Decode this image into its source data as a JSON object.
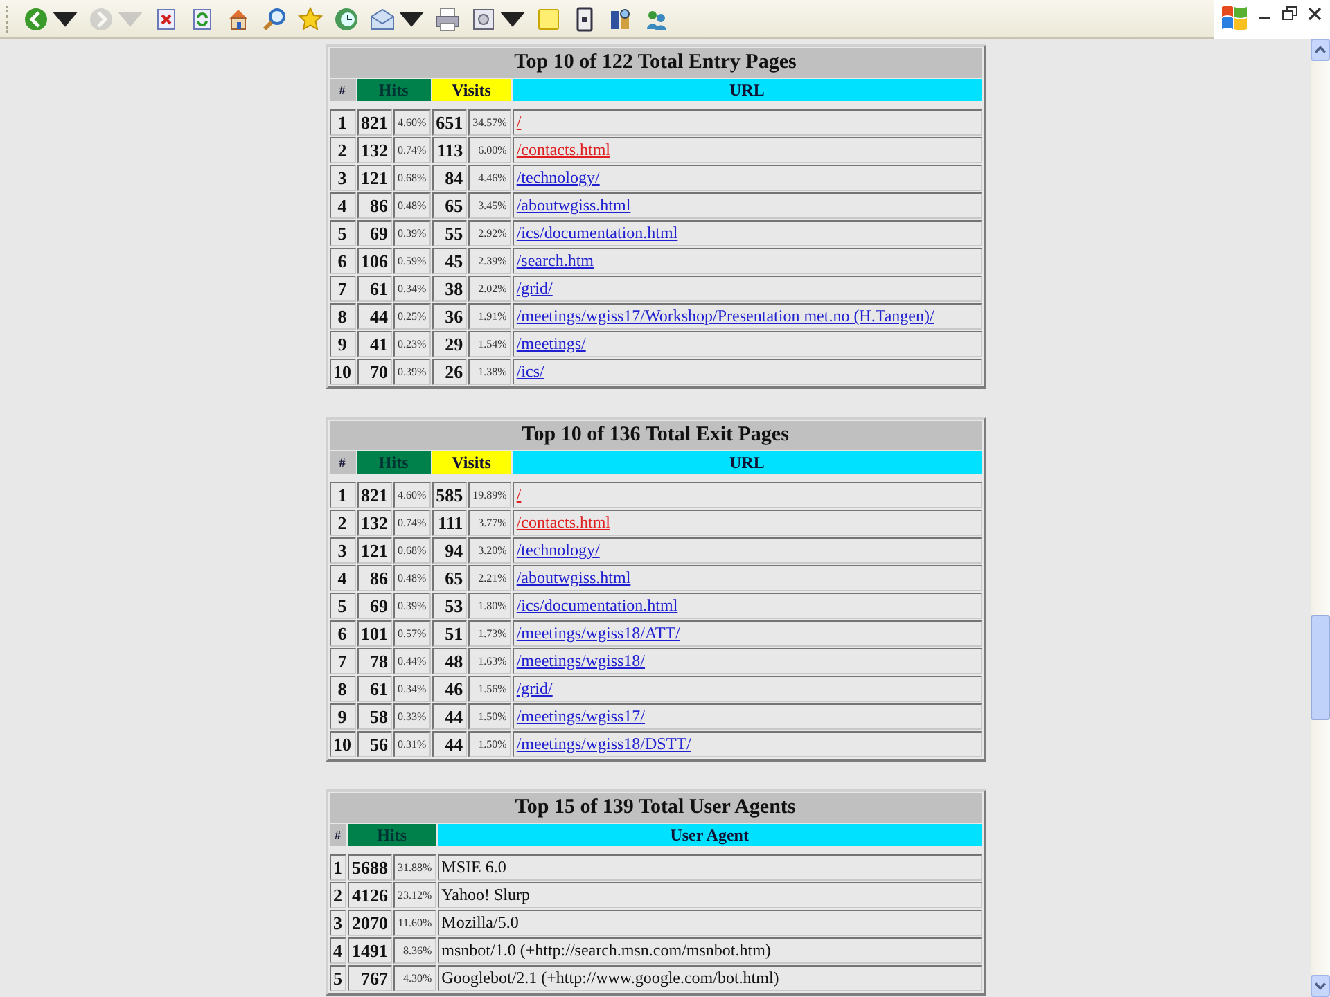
{
  "toolbar": {
    "buttons": [
      {
        "kind": "back",
        "dropdown": true,
        "disabled": false
      },
      {
        "kind": "forward",
        "dropdown": true,
        "disabled": true
      },
      {
        "kind": "stop",
        "dropdown": false,
        "disabled": false
      },
      {
        "kind": "refresh",
        "dropdown": false,
        "disabled": false
      },
      {
        "kind": "home",
        "dropdown": false,
        "disabled": false
      },
      {
        "kind": "search",
        "dropdown": false,
        "disabled": false
      },
      {
        "kind": "favorites",
        "dropdown": false,
        "disabled": false
      },
      {
        "kind": "history",
        "dropdown": false,
        "disabled": false
      },
      {
        "kind": "mail",
        "dropdown": true,
        "disabled": false
      },
      {
        "kind": "print",
        "dropdown": false,
        "disabled": false
      },
      {
        "kind": "edit",
        "dropdown": true,
        "disabled": false
      },
      {
        "kind": "note",
        "dropdown": false,
        "disabled": false
      },
      {
        "kind": "device",
        "dropdown": false,
        "disabled": false
      },
      {
        "kind": "research",
        "dropdown": false,
        "disabled": false
      },
      {
        "kind": "messenger",
        "dropdown": false,
        "disabled": false
      }
    ],
    "window_controls": [
      {
        "kind": "minimize"
      },
      {
        "kind": "restore"
      },
      {
        "kind": "close"
      }
    ]
  },
  "tables": [
    {
      "kind": "pages",
      "title": "Top 10 of 122 Total Entry Pages",
      "columns": [
        {
          "kind": "rank",
          "label": "#",
          "color": "#c0c0c0"
        },
        {
          "kind": "count",
          "label": "Hits",
          "color": "#00804a"
        },
        {
          "kind": "count",
          "label": "Visits",
          "color": "#ffff00"
        },
        {
          "kind": "text",
          "label": "URL",
          "color": "#00e0ff"
        }
      ],
      "rows": [
        {
          "rank": "1",
          "hits": "821",
          "hits_pct": "4.60%",
          "visits": "651",
          "visits_pct": "34.57%",
          "text": "/",
          "visited": true
        },
        {
          "rank": "2",
          "hits": "132",
          "hits_pct": "0.74%",
          "visits": "113",
          "visits_pct": "6.00%",
          "text": "/contacts.html",
          "visited": true
        },
        {
          "rank": "3",
          "hits": "121",
          "hits_pct": "0.68%",
          "visits": "84",
          "visits_pct": "4.46%",
          "text": "/technology/",
          "visited": false
        },
        {
          "rank": "4",
          "hits": "86",
          "hits_pct": "0.48%",
          "visits": "65",
          "visits_pct": "3.45%",
          "text": "/aboutwgiss.html",
          "visited": false
        },
        {
          "rank": "5",
          "hits": "69",
          "hits_pct": "0.39%",
          "visits": "55",
          "visits_pct": "2.92%",
          "text": "/ics/documentation.html",
          "visited": false
        },
        {
          "rank": "6",
          "hits": "106",
          "hits_pct": "0.59%",
          "visits": "45",
          "visits_pct": "2.39%",
          "text": "/search.htm",
          "visited": false
        },
        {
          "rank": "7",
          "hits": "61",
          "hits_pct": "0.34%",
          "visits": "38",
          "visits_pct": "2.02%",
          "text": "/grid/",
          "visited": false
        },
        {
          "rank": "8",
          "hits": "44",
          "hits_pct": "0.25%",
          "visits": "36",
          "visits_pct": "1.91%",
          "text": "/meetings/wgiss17/Workshop/Presentation met.no (H.Tangen)/",
          "visited": false
        },
        {
          "rank": "9",
          "hits": "41",
          "hits_pct": "0.23%",
          "visits": "29",
          "visits_pct": "1.54%",
          "text": "/meetings/",
          "visited": false
        },
        {
          "rank": "10",
          "hits": "70",
          "hits_pct": "0.39%",
          "visits": "26",
          "visits_pct": "1.38%",
          "text": "/ics/",
          "visited": false
        }
      ]
    },
    {
      "kind": "pages",
      "title": "Top 10 of 136 Total Exit Pages",
      "columns": [
        {
          "kind": "rank",
          "label": "#",
          "color": "#c0c0c0"
        },
        {
          "kind": "count",
          "label": "Hits",
          "color": "#00804a"
        },
        {
          "kind": "count",
          "label": "Visits",
          "color": "#ffff00"
        },
        {
          "kind": "text",
          "label": "URL",
          "color": "#00e0ff"
        }
      ],
      "rows": [
        {
          "rank": "1",
          "hits": "821",
          "hits_pct": "4.60%",
          "visits": "585",
          "visits_pct": "19.89%",
          "text": "/",
          "visited": true
        },
        {
          "rank": "2",
          "hits": "132",
          "hits_pct": "0.74%",
          "visits": "111",
          "visits_pct": "3.77%",
          "text": "/contacts.html",
          "visited": true
        },
        {
          "rank": "3",
          "hits": "121",
          "hits_pct": "0.68%",
          "visits": "94",
          "visits_pct": "3.20%",
          "text": "/technology/",
          "visited": false
        },
        {
          "rank": "4",
          "hits": "86",
          "hits_pct": "0.48%",
          "visits": "65",
          "visits_pct": "2.21%",
          "text": "/aboutwgiss.html",
          "visited": false
        },
        {
          "rank": "5",
          "hits": "69",
          "hits_pct": "0.39%",
          "visits": "53",
          "visits_pct": "1.80%",
          "text": "/ics/documentation.html",
          "visited": false
        },
        {
          "rank": "6",
          "hits": "101",
          "hits_pct": "0.57%",
          "visits": "51",
          "visits_pct": "1.73%",
          "text": "/meetings/wgiss18/ATT/",
          "visited": false
        },
        {
          "rank": "7",
          "hits": "78",
          "hits_pct": "0.44%",
          "visits": "48",
          "visits_pct": "1.63%",
          "text": "/meetings/wgiss18/",
          "visited": false
        },
        {
          "rank": "8",
          "hits": "61",
          "hits_pct": "0.34%",
          "visits": "46",
          "visits_pct": "1.56%",
          "text": "/grid/",
          "visited": false
        },
        {
          "rank": "9",
          "hits": "58",
          "hits_pct": "0.33%",
          "visits": "44",
          "visits_pct": "1.50%",
          "text": "/meetings/wgiss17/",
          "visited": false
        },
        {
          "rank": "10",
          "hits": "56",
          "hits_pct": "0.31%",
          "visits": "44",
          "visits_pct": "1.50%",
          "text": "/meetings/wgiss18/DSTT/",
          "visited": false
        }
      ]
    },
    {
      "kind": "agents",
      "title": "Top 15 of 139 Total User Agents",
      "columns": [
        {
          "kind": "rank",
          "label": "#",
          "color": "#c0c0c0"
        },
        {
          "kind": "count",
          "label": "Hits",
          "color": "#00804a"
        },
        {
          "kind": "text",
          "label": "User Agent",
          "color": "#00e0ff"
        }
      ],
      "rows": [
        {
          "rank": "1",
          "hits": "5688",
          "hits_pct": "31.88%",
          "text": "MSIE 6.0"
        },
        {
          "rank": "2",
          "hits": "4126",
          "hits_pct": "23.12%",
          "text": "Yahoo! Slurp"
        },
        {
          "rank": "3",
          "hits": "2070",
          "hits_pct": "11.60%",
          "text": "Mozilla/5.0"
        },
        {
          "rank": "4",
          "hits": "1491",
          "hits_pct": "8.36%",
          "text": "msnbot/1.0 (+http://search.msn.com/msnbot.htm)"
        },
        {
          "rank": "5",
          "hits": "767",
          "hits_pct": "4.30%",
          "text": "Googlebot/2.1 (+http://www.google.com/bot.html)"
        }
      ]
    }
  ]
}
